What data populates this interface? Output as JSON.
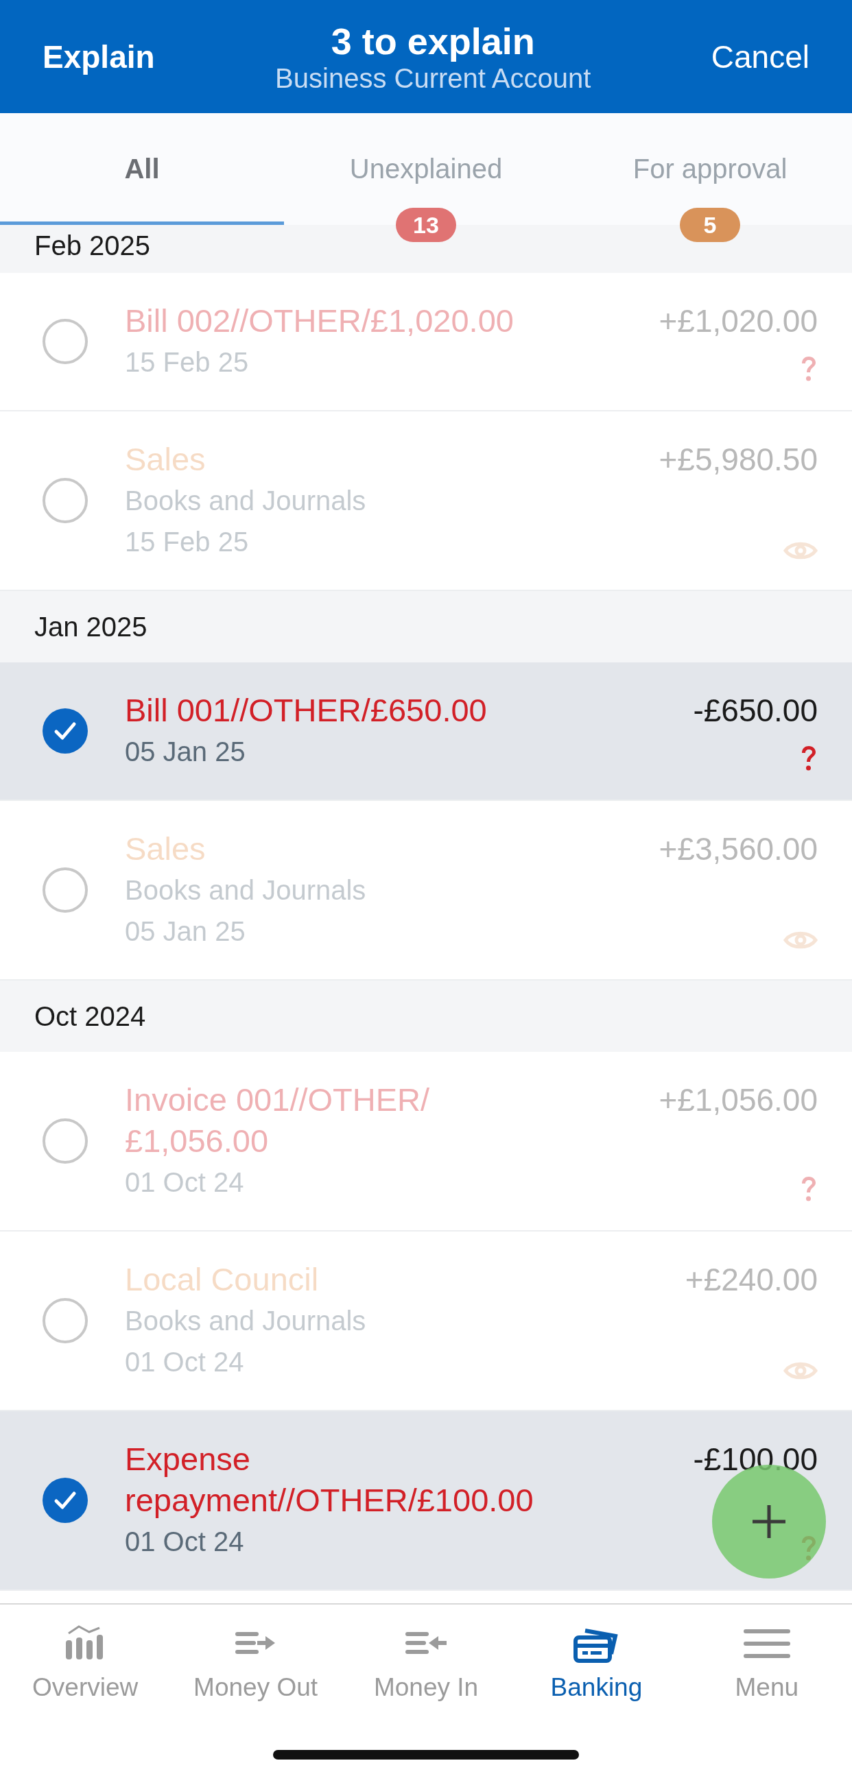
{
  "header": {
    "left_action": "Explain",
    "title": "3 to explain",
    "subtitle": "Business Current Account",
    "right_action": "Cancel"
  },
  "tabs": [
    {
      "label": "All",
      "selected": true
    },
    {
      "label": "Unexplained",
      "selected": false,
      "badge": "13",
      "color": "#e07373"
    },
    {
      "label": "For approval",
      "selected": false,
      "badge": "5",
      "color": "#d9935a"
    }
  ],
  "sections": [
    {
      "heading": "Feb 2025",
      "transactions": [
        {
          "title": "Bill 002//OTHER/£1,020.00",
          "date": "15 Feb 25",
          "amount": "+£1,020.00",
          "kind": "unexplained",
          "checked": false
        },
        {
          "title": "Sales",
          "category": "Books and Journals",
          "date": "15 Feb 25",
          "amount": "+£5,980.50",
          "kind": "approval",
          "checked": false
        }
      ]
    },
    {
      "heading": "Jan 2025",
      "transactions": [
        {
          "title": "Bill 001//OTHER/£650.00",
          "date": "05 Jan 25",
          "amount": "-£650.00",
          "kind": "unexplained",
          "checked": true
        },
        {
          "title": "Sales",
          "category": "Books and Journals",
          "date": "05 Jan 25",
          "amount": "+£3,560.00",
          "kind": "approval",
          "checked": false
        }
      ]
    },
    {
      "heading": "Oct 2024",
      "transactions": [
        {
          "title": "Invoice 001//OTHER/£1,056.00",
          "date": "01 Oct 24",
          "amount": "+£1,056.00",
          "kind": "unexplained",
          "checked": false
        },
        {
          "title": "Local Council",
          "category": "Books and Journals",
          "date": "01 Oct 24",
          "amount": "+£240.00",
          "kind": "approval",
          "checked": false
        },
        {
          "title": "Expense repayment//OTHER/£100.00",
          "date": "01 Oct 24",
          "amount": "-£100.00",
          "kind": "unexplained",
          "checked": true
        }
      ]
    }
  ],
  "nav": [
    {
      "label": "Overview",
      "kind": "overview",
      "selected": false
    },
    {
      "label": "Money Out",
      "kind": "money_out",
      "selected": false
    },
    {
      "label": "Money In",
      "kind": "money_in",
      "selected": false
    },
    {
      "label": "Banking",
      "kind": "banking",
      "selected": true
    },
    {
      "label": "Menu",
      "kind": "menu",
      "selected": false
    }
  ]
}
